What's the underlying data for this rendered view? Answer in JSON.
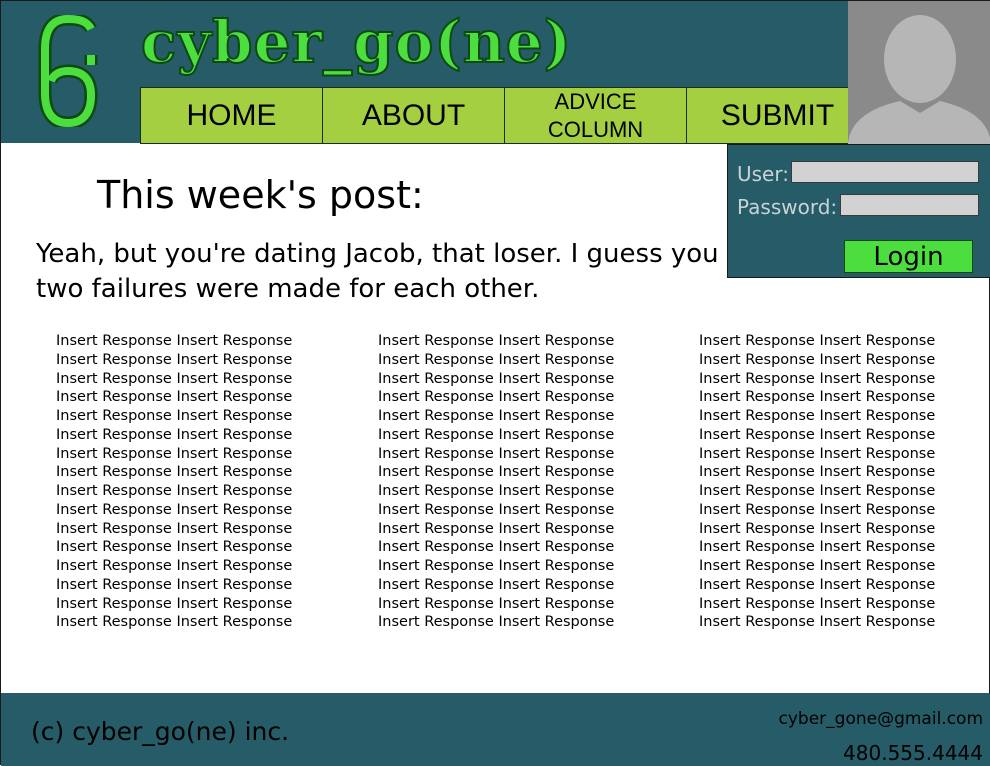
{
  "site": {
    "logo_icon": "cg-monogram-icon",
    "brand": "cyber_go(ne)",
    "colors": {
      "header_bg": "#255c68",
      "brand_green": "#4cde3e",
      "nav_green": "#a3cf40"
    }
  },
  "nav": {
    "home": "HOME",
    "about": "ABOUT",
    "advice": "ADVICE\nCOLUMN",
    "submit": "SUBMIT"
  },
  "login": {
    "user_label": "User:",
    "password_label": "Password:",
    "user_value": "",
    "password_value": "",
    "button": "Login",
    "avatar_icon": "user-avatar-icon"
  },
  "post": {
    "heading": "This week's post:",
    "text": "Yeah, but you're dating Jacob, that loser. I guess you two failures were made for each other."
  },
  "responses": {
    "columns": [
      [
        "Insert Response Insert Response",
        "Insert Response Insert Response",
        "Insert Response Insert Response",
        "Insert Response Insert Response",
        "Insert Response Insert Response",
        "Insert Response Insert Response",
        "Insert Response Insert Response",
        "Insert Response Insert Response",
        "Insert Response Insert Response",
        "Insert Response Insert Response",
        "Insert Response Insert Response",
        "Insert Response Insert Response",
        "Insert Response Insert Response",
        "Insert Response Insert Response",
        "Insert Response Insert Response",
        "Insert Response Insert Response"
      ],
      [
        "Insert Response Insert Response",
        "Insert Response Insert Response",
        "Insert Response Insert Response",
        "Insert Response Insert Response",
        "Insert Response Insert Response",
        "Insert Response Insert Response",
        "Insert Response Insert Response",
        "Insert Response Insert Response",
        "Insert Response Insert Response",
        "Insert Response Insert Response",
        "Insert Response Insert Response",
        "Insert Response Insert Response",
        "Insert Response Insert Response",
        "Insert Response Insert Response",
        "Insert Response Insert Response",
        "Insert Response Insert Response"
      ],
      [
        "Insert Response Insert Response",
        "Insert Response Insert Response",
        "Insert Response Insert Response",
        "Insert Response Insert Response",
        "Insert Response Insert Response",
        "Insert Response Insert Response",
        "Insert Response Insert Response",
        "Insert Response Insert Response",
        "Insert Response Insert Response",
        "Insert Response Insert Response",
        "Insert Response Insert Response",
        "Insert Response Insert Response",
        "Insert Response Insert Response",
        "Insert Response Insert Response",
        "Insert Response Insert Response",
        "Insert Response Insert Response"
      ]
    ]
  },
  "footer": {
    "copyright": "(c) cyber_go(ne) inc.",
    "email": "cyber_gone@gmail.com",
    "phone": "480.555.4444"
  }
}
